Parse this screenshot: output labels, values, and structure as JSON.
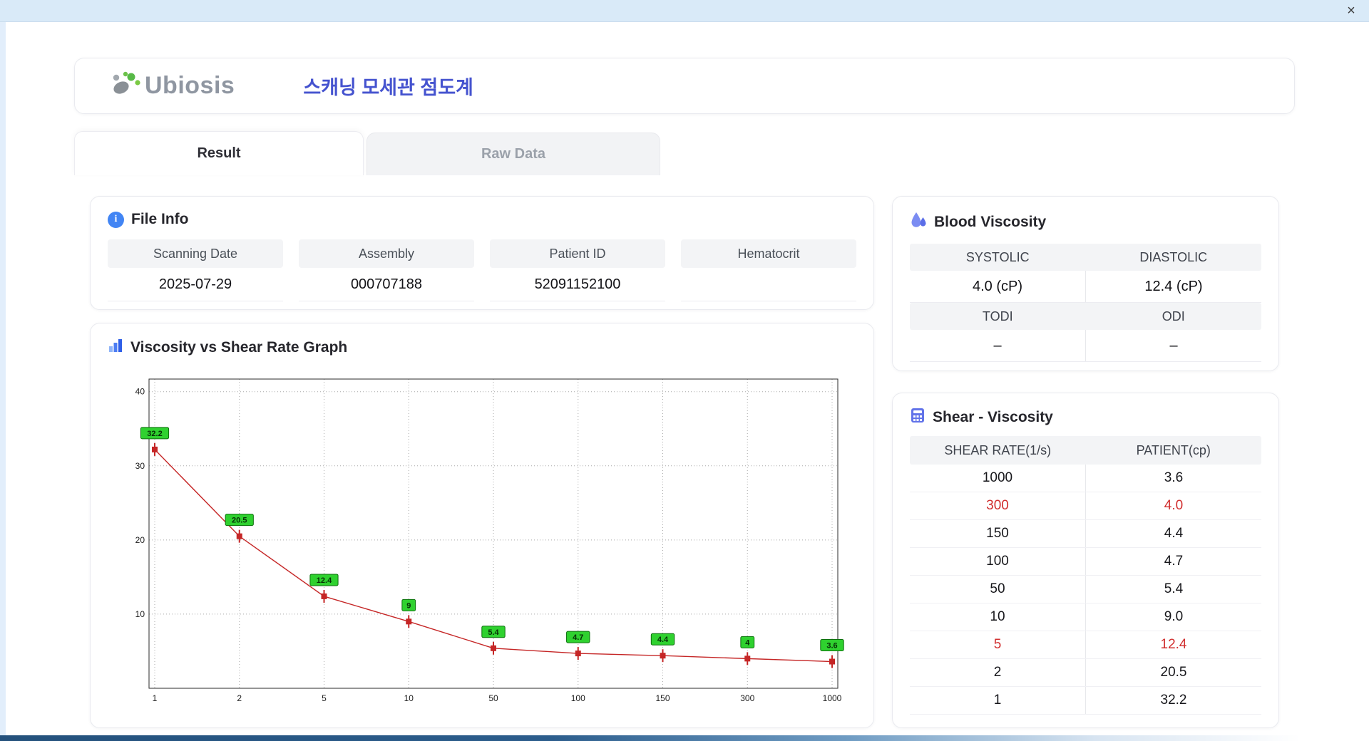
{
  "window": {
    "close_label": "×"
  },
  "header": {
    "logo_text": "Ubiosis",
    "title": "스캐닝 모세관 점도계"
  },
  "tabs": [
    {
      "label": "Result",
      "active": true
    },
    {
      "label": "Raw Data",
      "active": false
    }
  ],
  "file_info": {
    "title": "File Info",
    "fields": [
      {
        "label": "Scanning Date",
        "value": "2025-07-29"
      },
      {
        "label": "Assembly",
        "value": "000707188"
      },
      {
        "label": "Patient ID",
        "value": "52091152100"
      },
      {
        "label": "Hematocrit",
        "value": ""
      }
    ]
  },
  "blood_viscosity": {
    "title": "Blood Viscosity",
    "groups": [
      {
        "cells": [
          {
            "header": "SYSTOLIC",
            "value": "4.0 (cP)"
          },
          {
            "header": "DIASTOLIC",
            "value": "12.4 (cP)"
          }
        ]
      },
      {
        "cells": [
          {
            "header": "TODI",
            "value": "–"
          },
          {
            "header": "ODI",
            "value": "–"
          }
        ]
      }
    ]
  },
  "shear_viscosity": {
    "title": "Shear - Viscosity",
    "columns": [
      "SHEAR RATE(1/s)",
      "PATIENT(cp)"
    ],
    "rows": [
      {
        "shear": "1000",
        "patient": "3.6",
        "highlight": false
      },
      {
        "shear": "300",
        "patient": "4.0",
        "highlight": true
      },
      {
        "shear": "150",
        "patient": "4.4",
        "highlight": false
      },
      {
        "shear": "100",
        "patient": "4.7",
        "highlight": false
      },
      {
        "shear": "50",
        "patient": "5.4",
        "highlight": false
      },
      {
        "shear": "10",
        "patient": "9.0",
        "highlight": false
      },
      {
        "shear": "5",
        "patient": "12.4",
        "highlight": true
      },
      {
        "shear": "2",
        "patient": "20.5",
        "highlight": false
      },
      {
        "shear": "1",
        "patient": "32.2",
        "highlight": false
      }
    ]
  },
  "chart_data": {
    "type": "line",
    "title": "Viscosity vs Shear Rate Graph",
    "categories": [
      1,
      2,
      5,
      10,
      50,
      100,
      150,
      300,
      1000
    ],
    "values": [
      32.2,
      20.5,
      12.4,
      9,
      5.4,
      4.7,
      4.4,
      4,
      3.6
    ],
    "point_labels": [
      "32.2",
      "20.5",
      "12.4",
      "9",
      "5.4",
      "4.7",
      "4.4",
      "4",
      "3.6"
    ],
    "xlabel": "",
    "ylabel": "",
    "ylim": [
      0,
      41.7
    ],
    "yticks": [
      10,
      20,
      30,
      40
    ],
    "grid": true,
    "legend": "none"
  },
  "colors": {
    "accent_blue": "#4553cf",
    "highlight_red": "#d12f2f",
    "line_red": "#c52626",
    "marker_red": "#c52626",
    "label_green": "#2fd12f",
    "label_border": "#0c6e0c"
  }
}
